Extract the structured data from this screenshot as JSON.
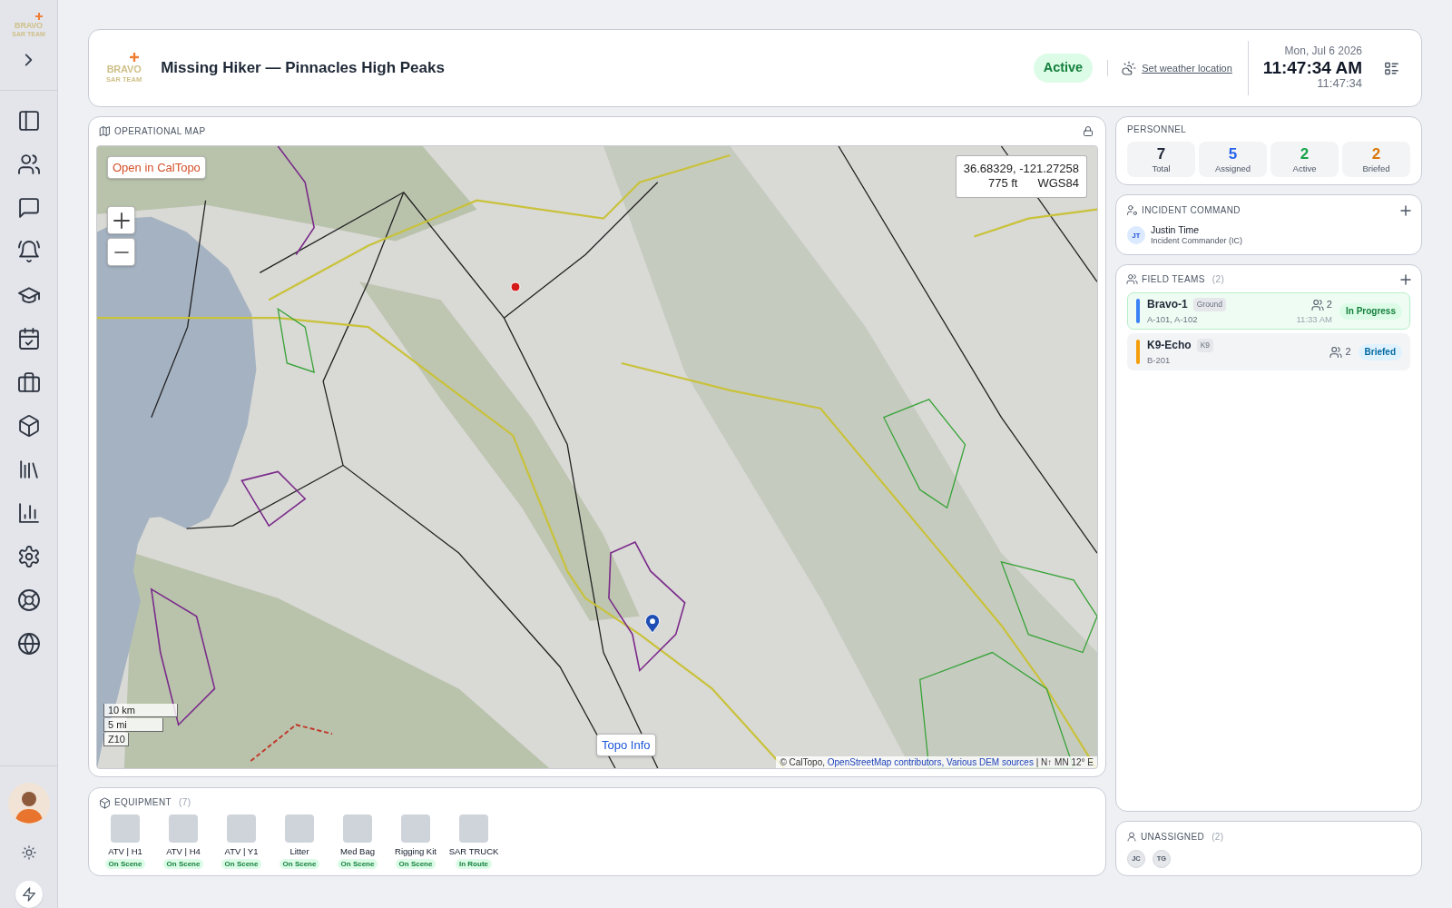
{
  "sidebar": {
    "logo": {
      "name": "BRAVO",
      "tagline": "SAR TEAM"
    }
  },
  "header": {
    "logo": {
      "name": "BRAVO",
      "tagline": "SAR TEAM"
    },
    "title": "Missing Hiker — Pinnacles High Peaks",
    "status": {
      "label": "Active",
      "kind": "active"
    },
    "weather_link": "Set weather location",
    "clock": {
      "date": "Mon, Jul 6 2026",
      "time": "11:47:34 AM",
      "time_24h": "11:47:34"
    }
  },
  "map": {
    "title": "OPERATIONAL MAP",
    "open_button": "Open in CalTopo",
    "coordinates": "36.68329, -121.27258",
    "elevation": "775 ft",
    "datum": "WGS84",
    "scale": [
      "10 km",
      "5 mi"
    ],
    "zoom": "Z10",
    "info_button": "Topo Info",
    "attribution": [
      {
        "kind": "text",
        "text": "© CalTopo,"
      },
      {
        "kind": "link",
        "text": "OpenStreetMap contributors,"
      },
      {
        "kind": "link",
        "text": "Various DEM sources"
      },
      {
        "kind": "text",
        "text": "| N↑ MN 12° E"
      }
    ]
  },
  "equipment": {
    "title": "EQUIPMENT",
    "count": "(7)",
    "items": [
      {
        "name": "ATV | H1",
        "status": "On Scene"
      },
      {
        "name": "ATV | H4",
        "status": "On Scene"
      },
      {
        "name": "ATV | Y1",
        "status": "On Scene"
      },
      {
        "name": "Litter",
        "status": "On Scene"
      },
      {
        "name": "Med Bag",
        "status": "On Scene"
      },
      {
        "name": "Rigging Kit",
        "status": "On Scene"
      },
      {
        "name": "SAR TRUCK",
        "status": "In Route"
      }
    ]
  },
  "personnel": {
    "title": "PERSONNEL",
    "stats": [
      {
        "value": "7",
        "label": "Total",
        "color": "#1f2937"
      },
      {
        "value": "5",
        "label": "Assigned",
        "color": "#2563eb"
      },
      {
        "value": "2",
        "label": "Active",
        "color": "#16a34a"
      },
      {
        "value": "2",
        "label": "Briefed",
        "color": "#d97706"
      }
    ]
  },
  "incident_command": {
    "title": "INCIDENT COMMAND",
    "members": [
      {
        "initials": "JT",
        "name": "Justin Time",
        "role": "Incident Commander (IC)"
      }
    ]
  },
  "field_teams": {
    "title": "FIELD TEAMS",
    "count": "(2)",
    "teams": [
      {
        "kind": "in_progress",
        "name": "Bravo-1",
        "type": "Ground",
        "assignments": "A-101, A-102",
        "members": "2",
        "time": "11:33 AM",
        "status": "In Progress",
        "color": "#3b82f6"
      },
      {
        "kind": "briefed",
        "name": "K9-Echo",
        "type": "K9",
        "assignments": "B-201",
        "members": "2",
        "status": "Briefed",
        "color": "#f59e0b"
      }
    ]
  },
  "unassigned": {
    "title": "UNASSIGNED",
    "count": "(2)",
    "people": [
      {
        "initials": "JC"
      },
      {
        "initials": "TG"
      }
    ]
  }
}
